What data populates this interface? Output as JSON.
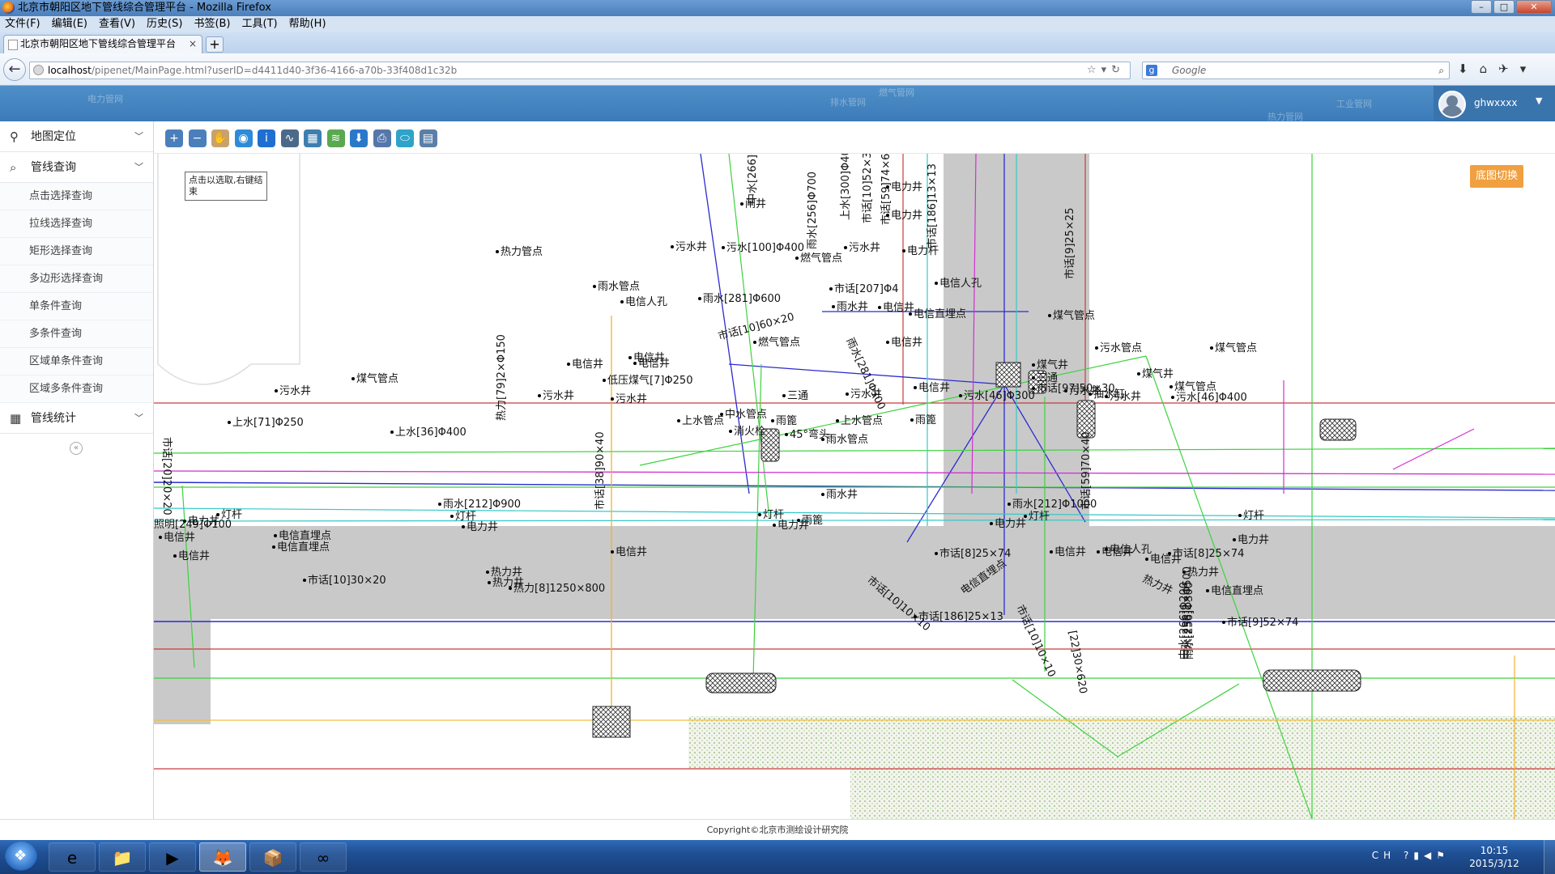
{
  "window": {
    "title": "北京市朝阳区地下管线综合管理平台 - Mozilla Firefox",
    "controls": [
      "–",
      "□",
      "✕"
    ]
  },
  "menu": [
    "文件(F)",
    "编辑(E)",
    "查看(V)",
    "历史(S)",
    "书签(B)",
    "工具(T)",
    "帮助(H)"
  ],
  "tab": {
    "title": "北京市朝阳区地下管线综合管理平台",
    "close": "×",
    "new": "+"
  },
  "nav": {
    "url_host": "localhost",
    "url_path": "/pipenet/MainPage.html?userID=d4411d40-3f36-4166-a70b-33f408d1c32b",
    "search_engine": "g",
    "search_placeholder": "Google"
  },
  "header": {
    "ghost_tabs": [
      "电力管网",
      "排水管网",
      "燃气管网",
      "工业管网",
      "热力管网"
    ],
    "username": "ghwxxxx"
  },
  "sidebar": {
    "sections": [
      {
        "label": "地图定位",
        "icon": "location-pin-icon"
      },
      {
        "label": "管线查询",
        "icon": "search-icon"
      },
      {
        "label": "管线统计",
        "icon": "table-icon"
      }
    ],
    "query_items": [
      "点击选择查询",
      "拉线选择查询",
      "矩形选择查询",
      "多边形选择查询",
      "单条件查询",
      "多条件查询",
      "区域单条件查询",
      "区域多条件查询"
    ],
    "collapse": "«"
  },
  "toolbar": {
    "tools": [
      {
        "name": "zoom-in-icon",
        "glyph": "+",
        "color": "#4a7fbc"
      },
      {
        "name": "zoom-out-icon",
        "glyph": "−",
        "color": "#4a7fbc"
      },
      {
        "name": "pan-hand-icon",
        "glyph": "✋",
        "color": "#c9a26b"
      },
      {
        "name": "full-extent-globe-icon",
        "glyph": "◉",
        "color": "#2e8bd8"
      },
      {
        "name": "info-icon",
        "glyph": "i",
        "color": "#1f6fd1"
      },
      {
        "name": "measure-line-icon",
        "glyph": "∿",
        "color": "#4b6a8a"
      },
      {
        "name": "measure-area-icon",
        "glyph": "▦",
        "color": "#3d7fb0"
      },
      {
        "name": "layers-icon",
        "glyph": "≋",
        "color": "#5aa84f"
      },
      {
        "name": "download-icon",
        "glyph": "⬇",
        "color": "#2a78c8"
      },
      {
        "name": "print-icon",
        "glyph": "⎙",
        "color": "#5577aa"
      },
      {
        "name": "clear-icon",
        "glyph": "⬭",
        "color": "#2fa3c9"
      },
      {
        "name": "calculator-icon",
        "glyph": "▤",
        "color": "#5b7fa8"
      }
    ]
  },
  "map": {
    "tooltip": "点击以选取,右键结束",
    "basemap_button": "底图切换",
    "labels": [
      "热力管点",
      "雨水管点",
      "电信人孔",
      "雨水[281]Φ600",
      "污水井",
      "污水[100]Φ400",
      "燃气管点",
      "闸井",
      "中水[266]Φ200",
      "雨水[256]Φ700",
      "上水[300]Φ400",
      "市话[10]52×36",
      "市话[59]74×64",
      "电力井",
      "电力井",
      "市话[186]13×13",
      "电力杆",
      "污水井",
      "市话[207]Φ4",
      "雨水井",
      "电信井",
      "电信人孔",
      "电信直埋点",
      "市话[9]25×25",
      "煤气管点",
      "市话[10]60×20",
      "燃气管点",
      "电信井",
      "电信井",
      "雨水[281]Φ300",
      "电信井",
      "煤气井",
      "污水管点",
      "煤气管点",
      "煤气井",
      "三通",
      "煤气管点",
      "电信井",
      "污水井",
      "污水井",
      "煤气管点",
      "污水井",
      "污水井",
      "抽水缸",
      "污水[46]Φ300",
      "市话[97]50×30",
      "污水井",
      "污水[46]Φ400",
      "热力[79]2×Φ150",
      "电信井",
      "低压煤气[7]Φ250",
      "三通",
      "污水井",
      "上水[71]Φ250",
      "上水[36]Φ400",
      "中水管点",
      "上水管点",
      "上水管点",
      "雨篦",
      "雨篦",
      "消火栓",
      "45°弯头",
      "雨水管点",
      "市话[20]20×20",
      "市话[38]90×40",
      "雨水井",
      "雨水[212]Φ900",
      "雨水[212]Φ1000",
      "市话[59]70×40",
      "照明[249]Φ100",
      "电力井",
      "灯杆",
      "灯杆",
      "电力井",
      "灯杆",
      "电力井",
      "雨篦",
      "电力井",
      "灯杆",
      "灯杆",
      "电力井",
      "电信井",
      "电信直埋点",
      "电信井",
      "电信直埋点",
      "电信井",
      "电信井",
      "电信井",
      "电信人孔",
      "电信井",
      "市话[8]25×74",
      "市话[8]25×74",
      "热力井",
      "热力井",
      "热力[8]1250×800",
      "市话[10]30×20",
      "市话[10]10×10",
      "电信直埋点",
      "市话[186]25×13",
      "市话[10]10×10",
      "热力井",
      "热力井",
      "电信直埋点",
      "市话[9]52×74",
      "[22]30×620",
      "中水[266]Φ200",
      "雨水[256]Φ300",
      "中水[256]2×Φ500"
    ]
  },
  "footer": {
    "copyright": "Copyright©北京市测绘设计研究院"
  },
  "taskbar": {
    "apps": [
      "e",
      "📁",
      "▶",
      "🦊",
      "📦",
      "∞"
    ],
    "tray_lang": "CH",
    "time": "10:15",
    "date": "2015/3/12"
  }
}
